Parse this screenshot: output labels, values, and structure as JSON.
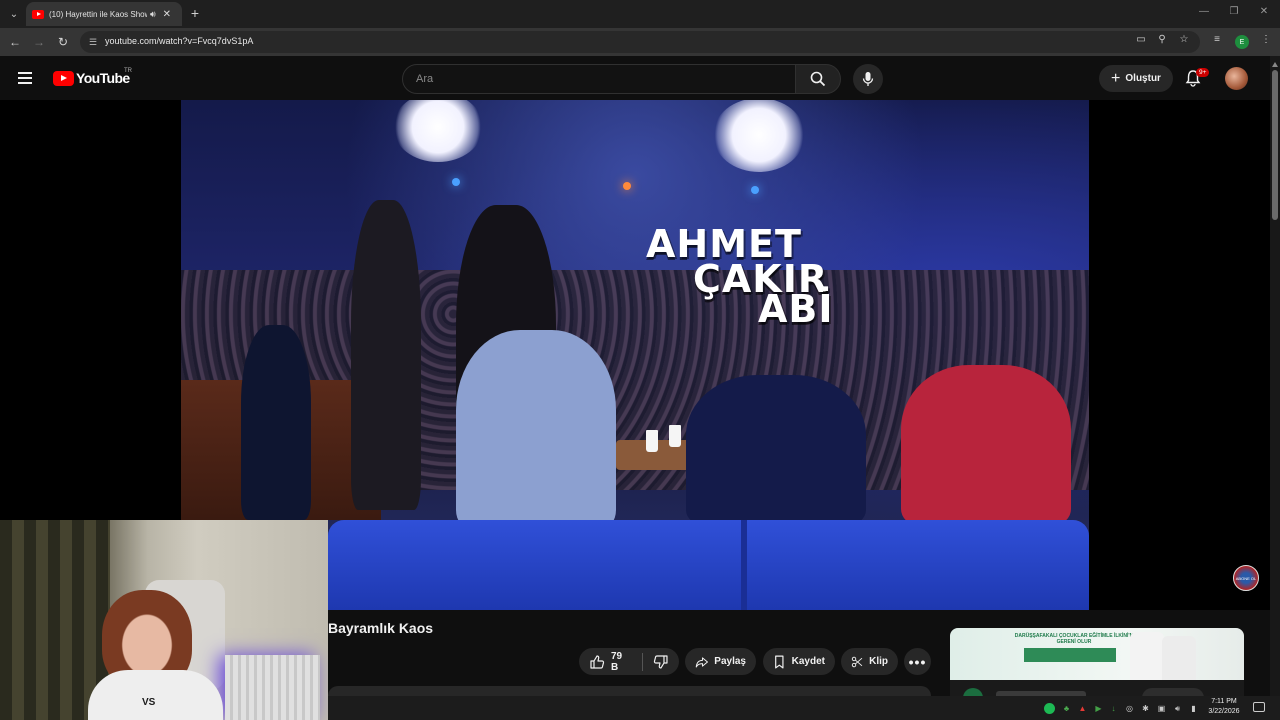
{
  "browser": {
    "tab_title": "(10) Hayrettin ile Kaos Show",
    "url": "youtube.com/watch?v=Fvcq7dvS1pA",
    "profile_initial": "E"
  },
  "youtube": {
    "logo_text": "YouTube",
    "region": "TR",
    "search_placeholder": "Ara",
    "create_label": "Oluştur",
    "notification_count": "9+"
  },
  "video": {
    "overlay_line1": "AHMET",
    "overlay_line2": "ÇAKIR",
    "overlay_line3": "ABİ",
    "shirt_text": "VS",
    "watermark_text": "ABONE OL",
    "title": "Bayramlık Kaos"
  },
  "actions": {
    "likes": "79 B",
    "share": "Paylaş",
    "save": "Kaydet",
    "clip": "Klip"
  },
  "ad": {
    "headline": "DARÜŞŞAFAKALI ÇOCUKLAR EĞİTİMLE İLKİNİ'N GERENİ OLUR"
  },
  "taskbar": {
    "time": "7:11 PM",
    "date": "3/22/2026"
  },
  "colors": {
    "yt_red": "#ff0000",
    "badge_red": "#cc0000",
    "background": "#0f0f0f",
    "pill": "#272727"
  }
}
